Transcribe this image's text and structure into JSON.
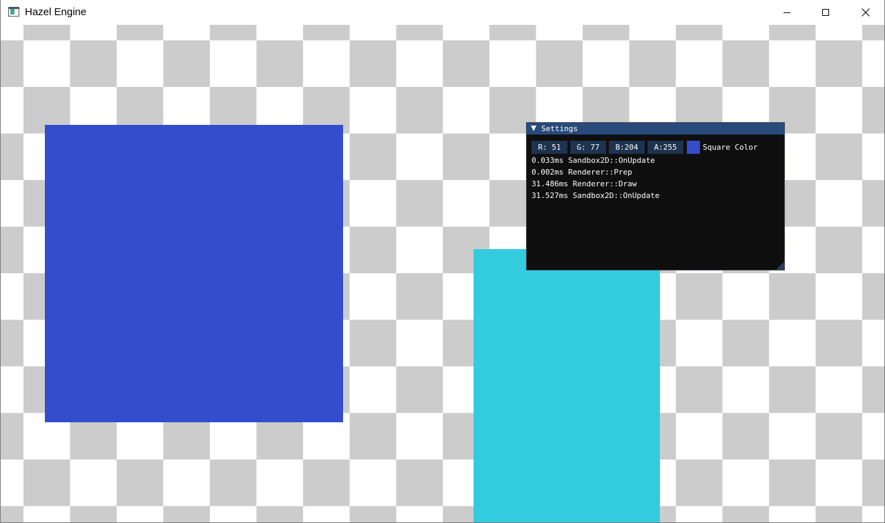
{
  "window": {
    "title": "Hazel Engine",
    "icon": "app-window-icon"
  },
  "title_controls": {
    "minimize_icon": "minimize-icon",
    "maximize_icon": "maximize-icon",
    "close_icon": "close-icon"
  },
  "scene": {
    "checkerboard_colors": [
      "#ffffff",
      "#cccccc"
    ],
    "blue_square_color": "#334dcc",
    "cyan_square_color": "#33ccdf"
  },
  "settings_panel": {
    "title": "Settings",
    "collapse_icon": "triangle-down-icon",
    "title_bar_color": "#294a7a",
    "background_color": "#0f0f0f",
    "color_edit": {
      "r": "R: 51",
      "g": "G: 77",
      "b": "B:204",
      "a": "A:255",
      "label": "Square Color",
      "swatch_color": "#334dcc"
    },
    "profile_results": [
      "0.033ms Sandbox2D::OnUpdate",
      "0.002ms Renderer::Prep",
      "31.486ms Renderer::Draw",
      "31.527ms Sandbox2D::OnUpdate"
    ]
  }
}
